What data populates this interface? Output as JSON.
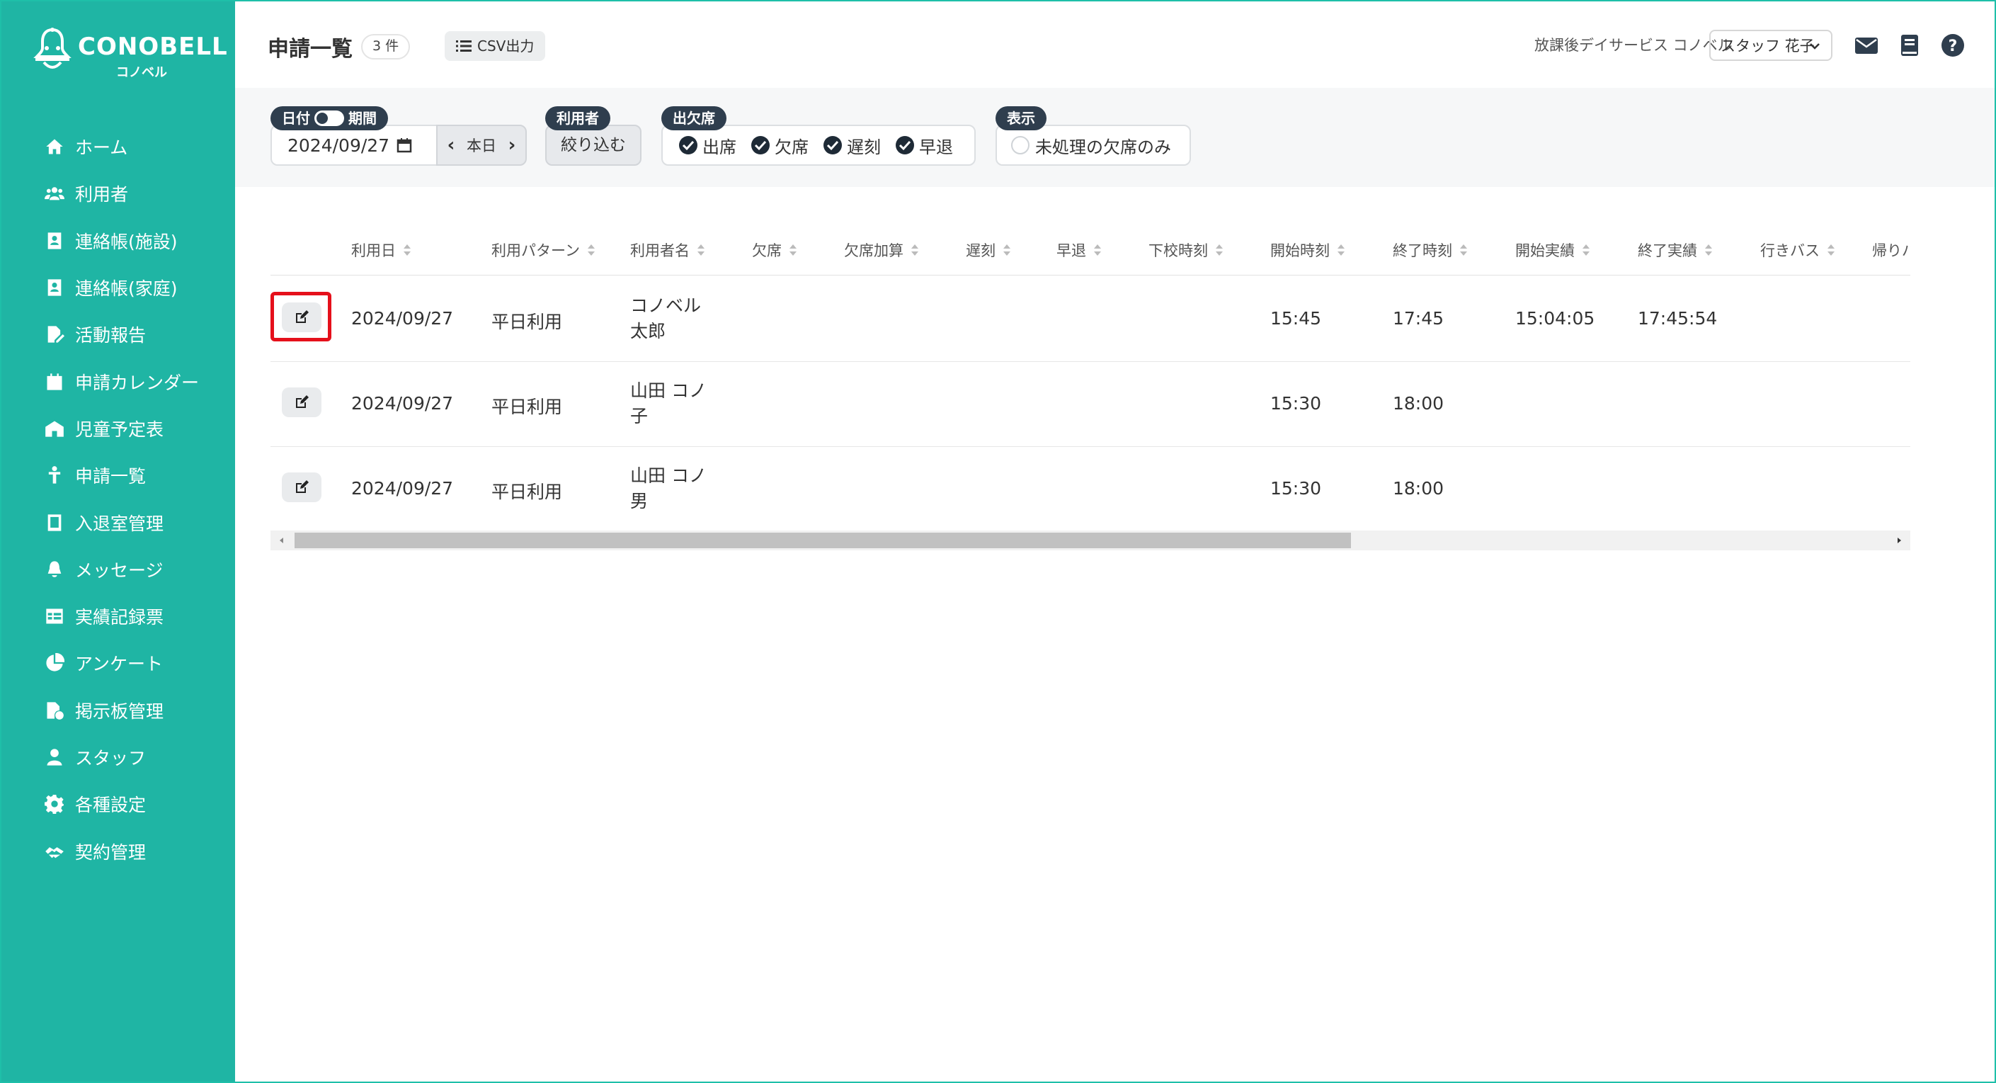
{
  "brand": {
    "name": "CONOBELL",
    "sub": "コノベル",
    "accent": "#1fb5a4"
  },
  "sidebar": {
    "items": [
      {
        "label": "ホーム",
        "icon": "home-icon"
      },
      {
        "label": "利用者",
        "icon": "users-icon"
      },
      {
        "label": "連絡帳(施設)",
        "icon": "contact-book-icon"
      },
      {
        "label": "連絡帳(家庭)",
        "icon": "contact-book-icon"
      },
      {
        "label": "活動報告",
        "icon": "file-edit-icon"
      },
      {
        "label": "申請カレンダー",
        "icon": "calendar-icon"
      },
      {
        "label": "児童予定表",
        "icon": "building-icon"
      },
      {
        "label": "申請一覧",
        "icon": "child-icon"
      },
      {
        "label": "入退室管理",
        "icon": "tablet-icon"
      },
      {
        "label": "メッセージ",
        "icon": "bell-icon"
      },
      {
        "label": "実績記録票",
        "icon": "table-icon"
      },
      {
        "label": "アンケート",
        "icon": "pie-chart-icon"
      },
      {
        "label": "掲示板管理",
        "icon": "file-settings-icon"
      },
      {
        "label": "スタッフ",
        "icon": "user-icon"
      },
      {
        "label": "各種設定",
        "icon": "gear-icon"
      },
      {
        "label": "契約管理",
        "icon": "handshake-icon"
      }
    ]
  },
  "header": {
    "title": "申請一覧",
    "count": "3 件",
    "csv_label": "CSV出力",
    "facility": "放課後デイサービス コノベル",
    "staff_selected": "スタッフ 花子"
  },
  "filters": {
    "date_label": "日付",
    "period_label": "期間",
    "date_value": "2024/09/27",
    "today_label": "本日",
    "user_label": "利用者",
    "narrow_label": "絞り込む",
    "attendance_label": "出欠席",
    "attendance_options": [
      "出席",
      "欠席",
      "遅刻",
      "早退"
    ],
    "display_label": "表示",
    "unprocessed_label": "未処理の欠席のみ"
  },
  "table": {
    "headers": [
      "利用日",
      "利用パターン",
      "利用者名",
      "欠席",
      "欠席加算",
      "遅刻",
      "早退",
      "下校時刻",
      "開始時刻",
      "終了時刻",
      "開始実績",
      "終了実績",
      "行きバス",
      "帰りバ"
    ],
    "rows": [
      {
        "date": "2024/09/27",
        "pattern": "平日利用",
        "name": "コノベル 太郎",
        "start": "15:45",
        "end": "17:45",
        "start_actual": "15:04:05",
        "end_actual": "17:45:54"
      },
      {
        "date": "2024/09/27",
        "pattern": "平日利用",
        "name": "山田 コノ子",
        "start": "15:30",
        "end": "18:00",
        "start_actual": "",
        "end_actual": ""
      },
      {
        "date": "2024/09/27",
        "pattern": "平日利用",
        "name": "山田 コノ男",
        "start": "15:30",
        "end": "18:00",
        "start_actual": "",
        "end_actual": ""
      }
    ]
  },
  "colors": {
    "highlight": "#e5101b",
    "label_dark": "#2f3e4e"
  }
}
